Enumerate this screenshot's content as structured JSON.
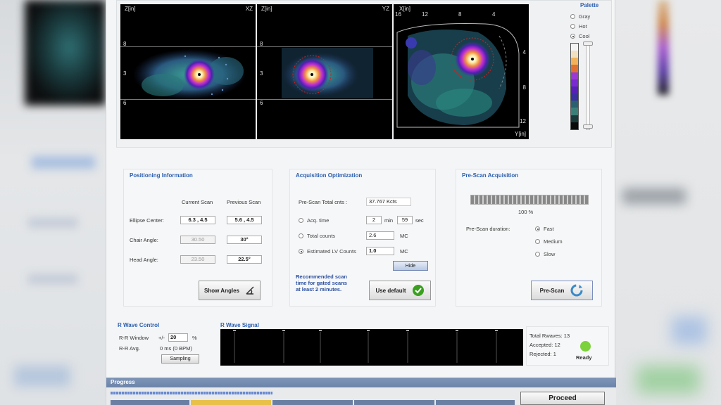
{
  "viewer": {
    "xz": {
      "axis_label": "Z[in]",
      "plane": "XZ",
      "ticks": [
        "8",
        "3",
        "6"
      ]
    },
    "yz": {
      "axis_label": "Z[in]",
      "plane": "YZ",
      "ticks": [
        "8",
        "3",
        "6"
      ]
    },
    "xy": {
      "axis_label": "X[in]",
      "top_ticks": [
        "16",
        "12",
        "8",
        "4"
      ],
      "right_ticks": [
        "4",
        "8",
        "12"
      ],
      "bottom_label": "Y[in]"
    }
  },
  "palette": {
    "title": "Palette",
    "options": [
      "Gray",
      "Hot",
      "Cool"
    ],
    "selected": "Cool",
    "colors": [
      "#f4f4f4",
      "#f0e0c0",
      "#f2b25a",
      "#e07030",
      "#9a38d8",
      "#7a2ad0",
      "#5820b8",
      "#3a30a0",
      "#2a6070",
      "#3a8078",
      "#1a3a3a",
      "#0a0a0a"
    ]
  },
  "positioning": {
    "title": "Positioning Information",
    "col_current": "Current Scan",
    "col_previous": "Previous Scan",
    "rows": [
      {
        "label": "Ellipse Center:",
        "current": "6.3 , 4.5",
        "previous": "5.6 , 4.5",
        "current_disabled": false
      },
      {
        "label": "Chair Angle:",
        "current": "30.50",
        "previous": "30°",
        "current_disabled": true
      },
      {
        "label": "Head Angle:",
        "current": "23.50",
        "previous": "22.5°",
        "current_disabled": true
      }
    ],
    "show_angles": "Show Angles"
  },
  "acquisition": {
    "title": "Acquisition Optimization",
    "total_label": "Pre-Scan Total cnts :",
    "total_value": "37.767 Kcts",
    "acq_time_label": "Acq. time",
    "acq_min": "2",
    "min_unit": "min",
    "acq_sec": "59",
    "sec_unit": "sec",
    "total_counts_label": "Total counts",
    "total_counts_value": "2.6",
    "mc_unit1": "MC",
    "lv_label": "Estimated LV Counts",
    "lv_value": "1.0",
    "mc_unit2": "MC",
    "selected": "Estimated LV Counts",
    "hide": "Hide",
    "rec_line1": "Recommended scan",
    "rec_line2": "time for gated scans",
    "rec_line3": "at least     2 minutes.",
    "use_default": "Use default"
  },
  "prescan": {
    "title": "Pre-Scan Acquisition",
    "progress_pct": "100 %",
    "progress_fraction": 1.0,
    "duration_label": "Pre-Scan duration:",
    "options": [
      "Fast",
      "Medium",
      "Slow"
    ],
    "selected": "Fast",
    "button": "Pre-Scan"
  },
  "rwave_control": {
    "title": "R Wave Control",
    "rr_window_label": "R-R Window",
    "pm": "+/-",
    "rr_window_value": "20",
    "pct": "%",
    "rr_avg_label": "R-R Avg.",
    "rr_avg_value": "0 ms (0 BPM)",
    "sampling": "Sampling"
  },
  "rwave_signal": {
    "title": "R Wave Signal"
  },
  "stats": {
    "total": "Total Rwaves: 13",
    "accepted": "Accepted: 12",
    "rejected": "Rejected: 1",
    "status": "Ready",
    "status_color": "#7bd23a"
  },
  "progress": {
    "title": "Progress",
    "proceed": "Proceed"
  }
}
